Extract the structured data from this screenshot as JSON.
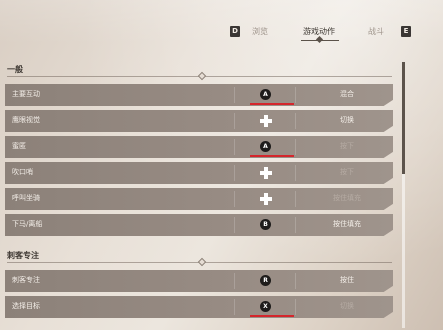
{
  "tabs": {
    "left_key": "D",
    "right_key": "E",
    "items": [
      "浏览",
      "游戏动作",
      "战斗"
    ]
  },
  "sections": [
    {
      "title": "一般",
      "rows": [
        {
          "label": "主要互动",
          "input": "A",
          "action": "混合",
          "highlight": true,
          "dim": false
        },
        {
          "label": "鹰眼视觉",
          "input": "dpad",
          "action": "切换",
          "highlight": false,
          "dim": false
        },
        {
          "label": "蜜匿",
          "input": "A",
          "action": "按下",
          "highlight": true,
          "dim": true
        },
        {
          "label": "吹口哨",
          "input": "dpad",
          "action": "按下",
          "highlight": false,
          "dim": true
        },
        {
          "label": "呼叫坐骑",
          "input": "dpad",
          "action": "按住填充",
          "highlight": false,
          "dim": true
        },
        {
          "label": "下马/离船",
          "input": "B",
          "action": "按住填充",
          "highlight": false,
          "dim": false
        }
      ]
    },
    {
      "title": "刺客专注",
      "rows": [
        {
          "label": "刺客专注",
          "input": "R",
          "action": "按住",
          "highlight": false,
          "dim": false
        },
        {
          "label": "选择目标",
          "input": "X",
          "action": "切换",
          "highlight": true,
          "dim": true
        }
      ]
    }
  ]
}
